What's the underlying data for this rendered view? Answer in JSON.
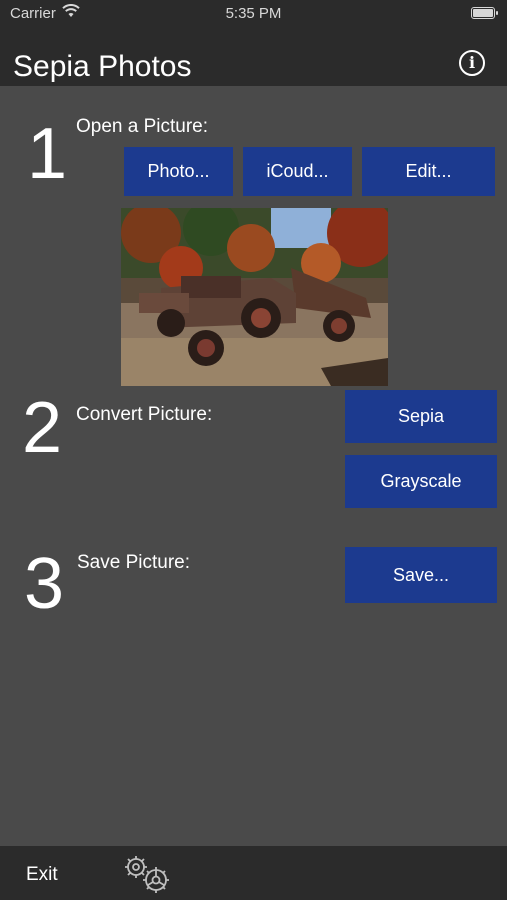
{
  "status_bar": {
    "carrier": "Carrier",
    "time": "5:35 PM",
    "wifi_icon": "wifi-icon",
    "battery_icon": "battery-icon"
  },
  "nav": {
    "title": "Sepia Photos",
    "info_icon": "info-circle-icon"
  },
  "steps": [
    {
      "number": "1",
      "label": "Open a Picture:",
      "buttons": [
        "Photo...",
        "iCoud...",
        "Edit..."
      ]
    },
    {
      "number": "2",
      "label": "Convert Picture:",
      "buttons": [
        "Sepia",
        "Grayscale"
      ]
    },
    {
      "number": "3",
      "label": "Save Picture:",
      "buttons": [
        "Save..."
      ]
    }
  ],
  "preview_image": {
    "subject": "rusty antique truck in autumn woods"
  },
  "bottom_bar": {
    "exit_label": "Exit",
    "settings_icon": "gears-icon"
  },
  "colors": {
    "background": "#4a4a4a",
    "bars": "#2b2b2b",
    "button": "#1c3a8f",
    "text": "#ffffff"
  }
}
